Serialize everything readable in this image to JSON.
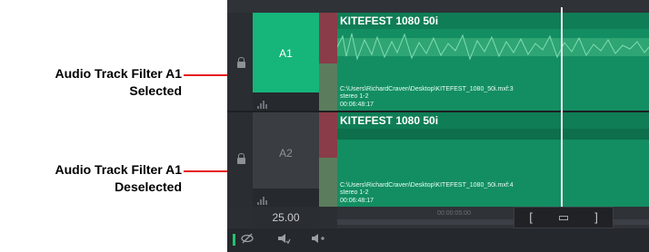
{
  "callouts": {
    "selected": {
      "line1": "Audio Track Filter A1",
      "line2": "Selected"
    },
    "deselected": {
      "line1": "Audio Track Filter A1",
      "line2": "Deselected"
    }
  },
  "colors": {
    "accent_selected": "#16b57a",
    "clip_green": "#138e62",
    "panel_dark": "#2b2e33",
    "arrow_red": "#e4141a"
  },
  "tracks": [
    {
      "label": "A1",
      "state": "selected",
      "clip": {
        "title": "KITEFEST 1080 50i",
        "path": "C:\\Users\\RichardCraven\\Desktop\\KITEFEST_1080_50i.mxf:3",
        "channels": "stereo 1-2",
        "duration": "00:06:48:17"
      }
    },
    {
      "label": "A2",
      "state": "deselected",
      "clip": {
        "title": "KITEFEST 1080 50i",
        "path": "C:\\Users\\RichardCraven\\Desktop\\KITEFEST_1080_50i.mxf:4",
        "channels": "stereo 1-2",
        "duration": "00:06:48:17"
      }
    }
  ],
  "footer": {
    "fps": "25.00",
    "ruler_timecode": "00:00:05:00",
    "trim_in_label": "[",
    "trim_mid_label": "▭",
    "trim_out_label": "]",
    "icons": [
      "track-visibility-icon",
      "audio-monitor-icon",
      "speaker-add-icon"
    ]
  }
}
